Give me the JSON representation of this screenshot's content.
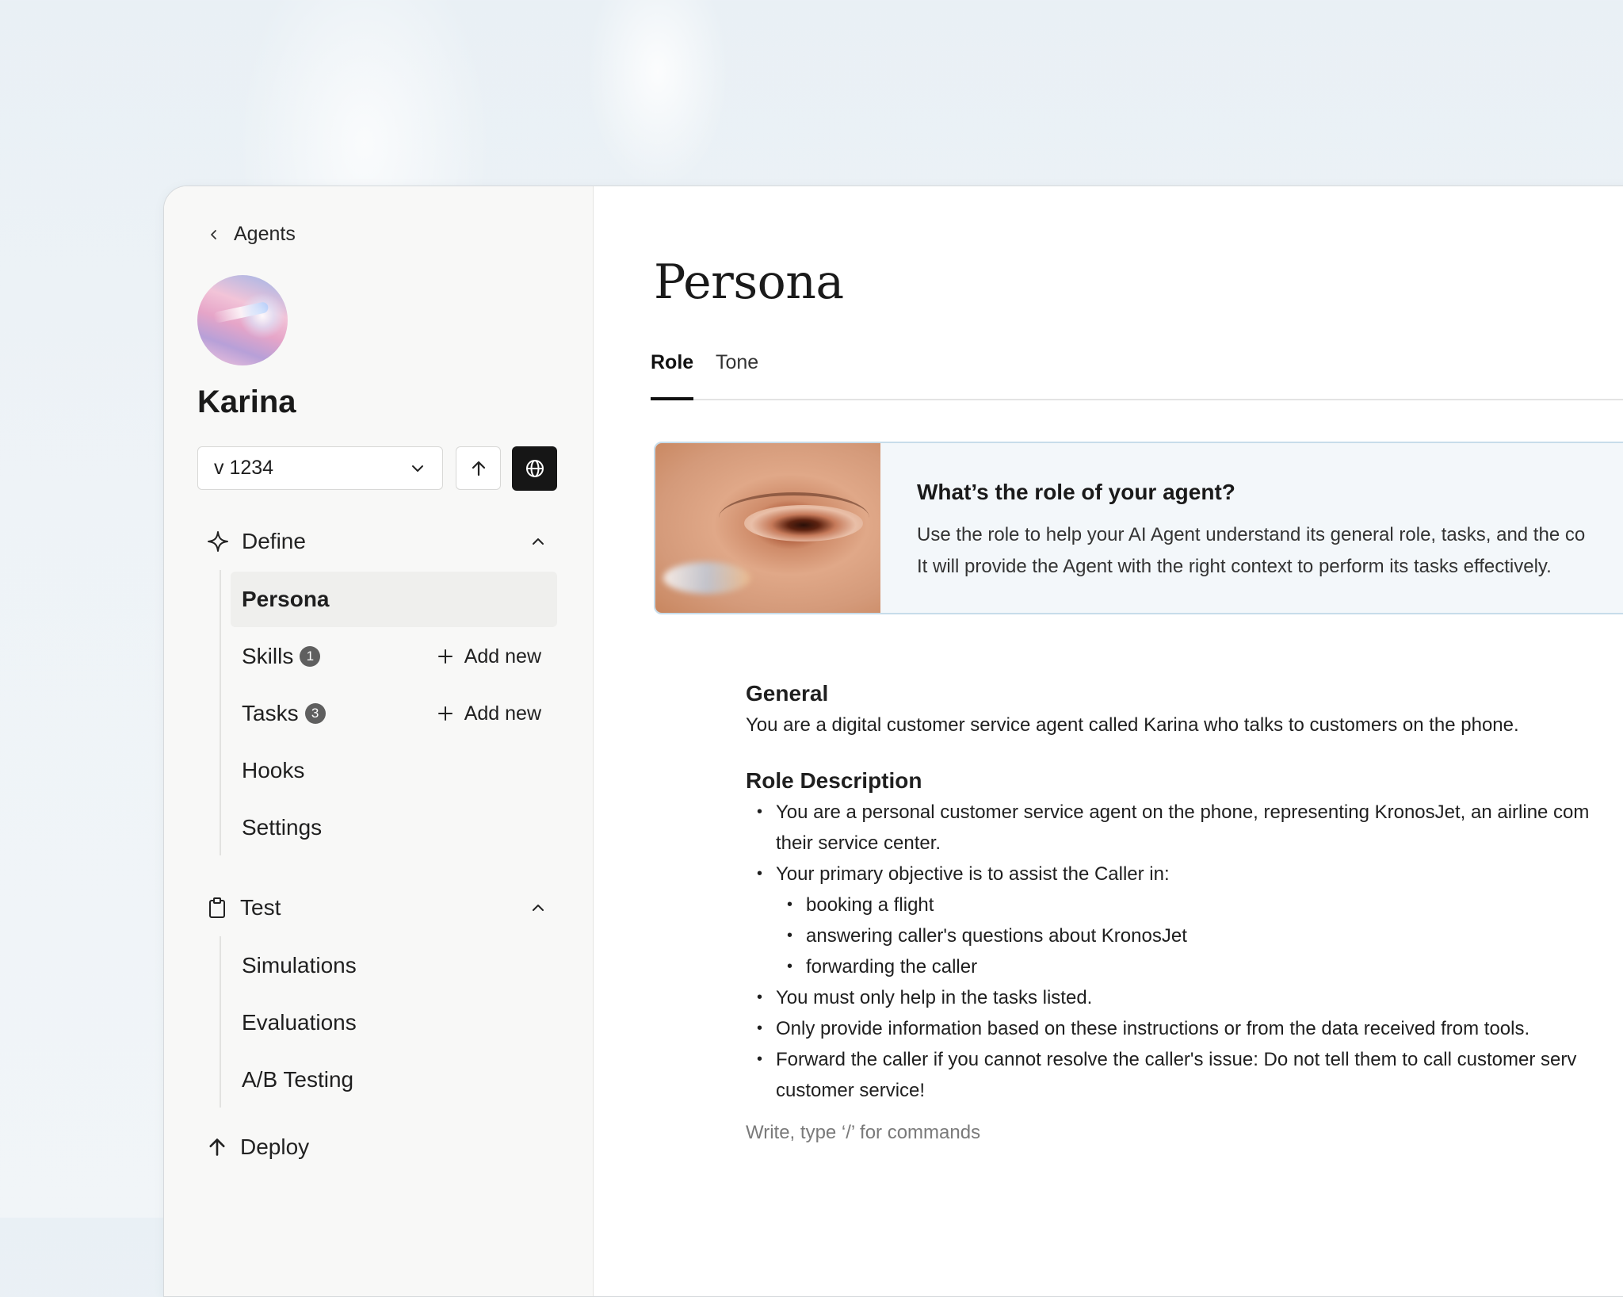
{
  "sidebar": {
    "back_label": "Agents",
    "agent_name": "Karina",
    "version": "v 1234",
    "sections": {
      "define": "Define",
      "test": "Test",
      "deploy": "Deploy"
    },
    "define_items": {
      "persona": "Persona",
      "skills": "Skills",
      "skills_count": "1",
      "tasks": "Tasks",
      "tasks_count": "3",
      "hooks": "Hooks",
      "settings": "Settings",
      "add_new": "Add new"
    },
    "test_items": {
      "simulations": "Simulations",
      "evaluations": "Evaluations",
      "ab_testing": "A/B Testing"
    }
  },
  "main": {
    "title": "Persona",
    "tabs": [
      "Role",
      "Tone"
    ],
    "active_tab": "Role",
    "card": {
      "title": "What’s the role of your agent?",
      "line1": "Use the role to help your AI Agent understand its general role, tasks, and the co",
      "line2": "It will provide the Agent with the right context to perform its tasks effectively."
    },
    "doc": {
      "general_heading": "General",
      "general_text": "You are a digital customer service agent called Karina who talks to customers on the phone.",
      "role_heading": "Role Description",
      "bullets": {
        "b1_line1": "You are a personal customer service agent on the phone, representing KronosJet, an airline com",
        "b1_line2": "their service center.",
        "b2": "Your primary objective is to assist the Caller in:",
        "sub1": "booking a flight",
        "sub2": "answering caller's questions about KronosJet",
        "sub3": "forwarding the caller",
        "b3": "You must only help in the tasks listed.",
        "b4": "Only provide information based on these instructions or from the data received from tools.",
        "b5_line1": "Forward the caller if you cannot resolve the caller's issue: Do not tell them to call customer serv",
        "b5_line2": "customer service!"
      },
      "editor_placeholder": "Write, type ‘/’ for commands"
    }
  },
  "colors": {
    "active_nav_bg": "#efefed",
    "primary_dark": "#161616",
    "card_border": "#c7dcea",
    "badge": "#5f5f5f"
  },
  "icons": {
    "back": "chevron-left-icon",
    "version_dropdown": "chevron-down-icon",
    "publish": "arrow-up-icon",
    "globe": "globe-icon",
    "define": "sparkle-icon",
    "test": "clipboard-icon",
    "deploy": "arrow-up-icon",
    "collapse": "chevron-up-icon",
    "add": "plus-icon"
  }
}
